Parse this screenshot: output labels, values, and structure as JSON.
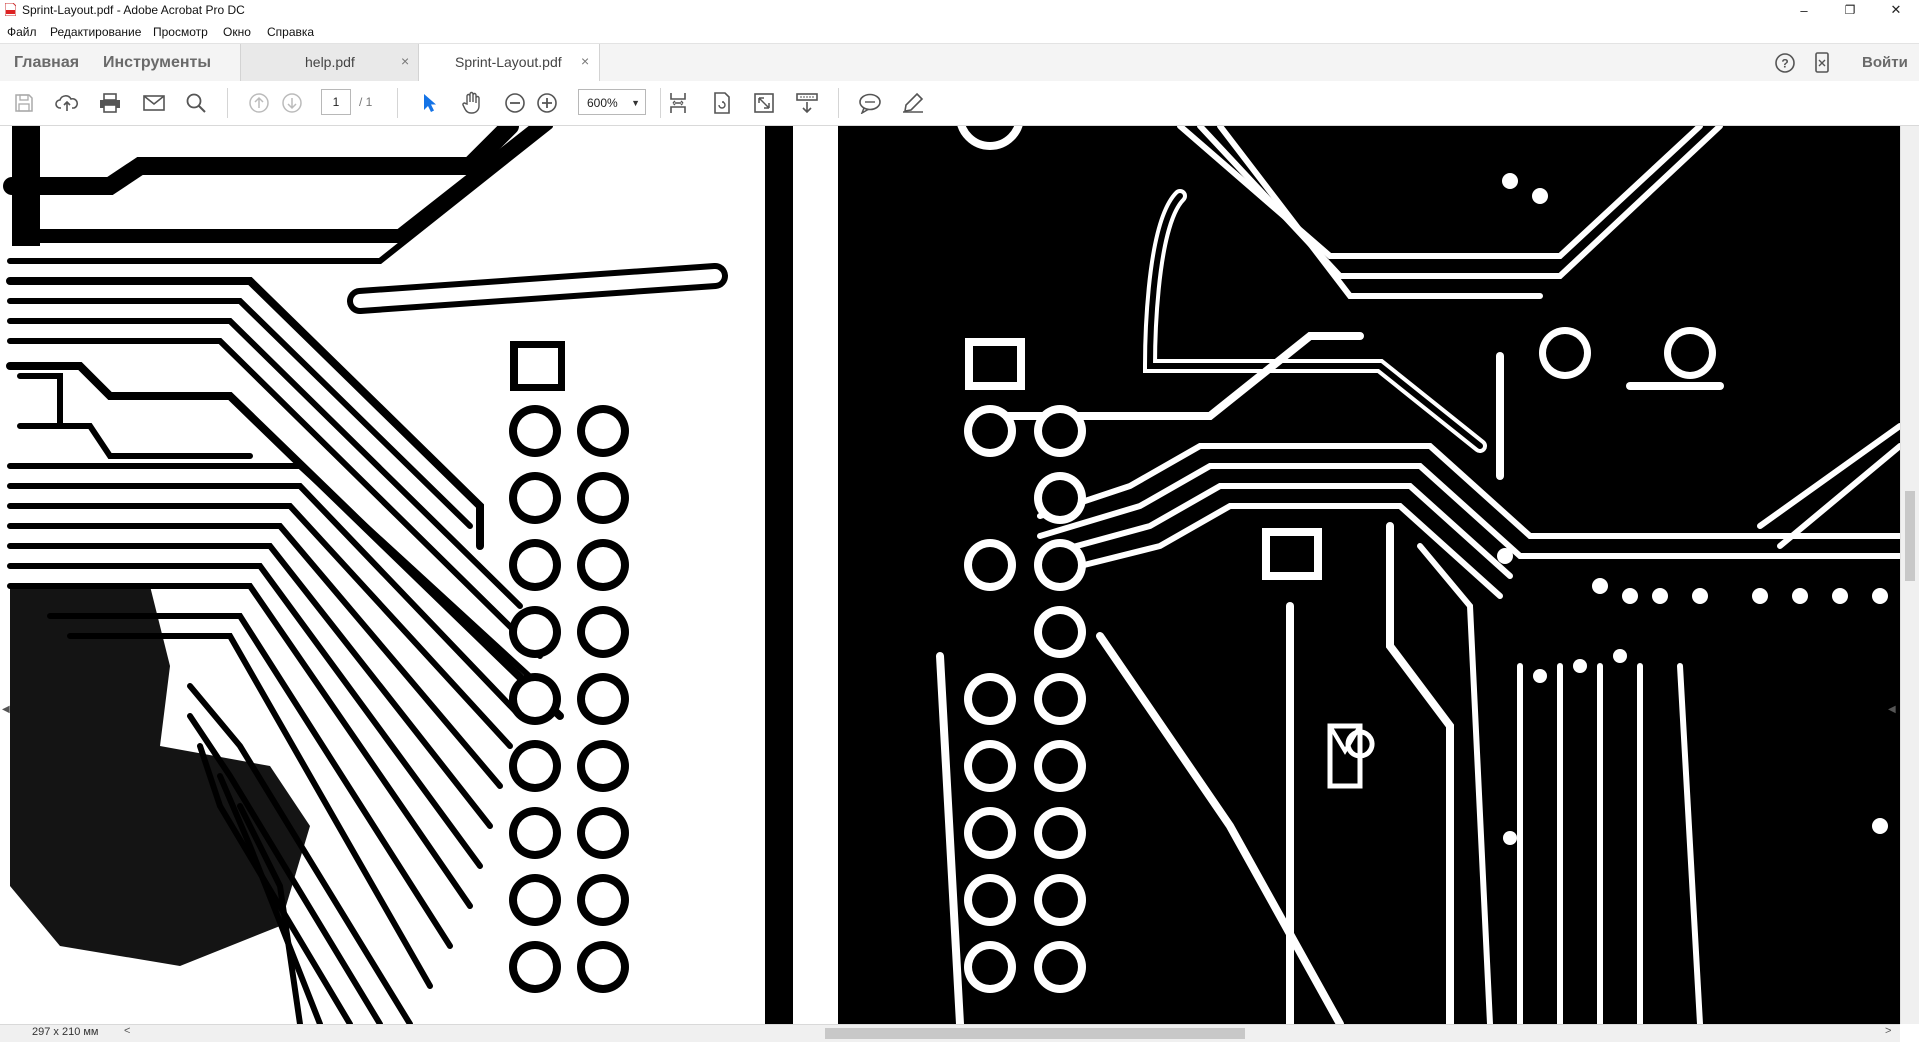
{
  "window": {
    "title": "Sprint-Layout.pdf - Adobe Acrobat Pro DC",
    "minimize": "–",
    "restore": "❐",
    "close": "✕"
  },
  "menu": {
    "items": [
      "Файл",
      "Редактирование",
      "Просмотр",
      "Окно",
      "Справка"
    ]
  },
  "tabs": {
    "home": "Главная",
    "tools": "Инструменты",
    "docs": [
      {
        "label": "help.pdf",
        "close": "×",
        "active": false
      },
      {
        "label": "Sprint-Layout.pdf",
        "close": "×",
        "active": true
      }
    ],
    "signin": "Войти"
  },
  "toolbar": {
    "page_current": "1",
    "page_total": "/ 1",
    "zoom": "600%",
    "accent_color": "#1473e6"
  },
  "status": {
    "page_size": "297 x 210 мм"
  },
  "icons": [
    "save-icon",
    "upload-icon",
    "print-icon",
    "mail-icon",
    "search-icon",
    "prev-page-icon",
    "next-page-icon",
    "select-arrow-icon",
    "hand-icon",
    "zoom-out-icon",
    "zoom-in-icon",
    "fit-width-icon",
    "rotate-icon",
    "fullscreen-icon",
    "scroll-mode-icon",
    "comment-icon",
    "pen-icon",
    "help-icon",
    "mobile-icon"
  ]
}
